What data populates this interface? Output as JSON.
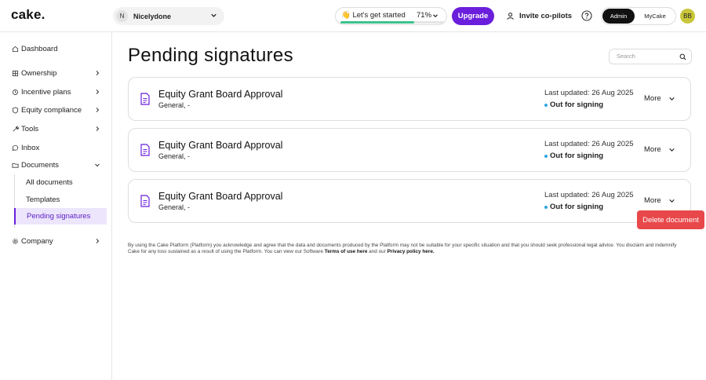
{
  "header": {
    "logo_text": "cake.",
    "company": {
      "initial": "N",
      "name": "Nicelydone"
    },
    "get_started": {
      "label": "👋 Let's get started",
      "percent_text": "71%",
      "progress_fraction": 0.71,
      "progress_color": "#3cc28c"
    },
    "upgrade_label": "Upgrade",
    "invite_label": "Invite co-pilots",
    "mode": {
      "admin_label": "Admin",
      "mycake_label": "MyCake",
      "selected": "Admin"
    },
    "user_initials": "BB",
    "accent_color": "#6b1fdc"
  },
  "sidebar": {
    "items": [
      {
        "label": "Dashboard",
        "icon": "home-icon",
        "has_chevron": false
      },
      {
        "label": "Ownership",
        "icon": "grid-icon",
        "has_chevron": true
      },
      {
        "label": "Incentive plans",
        "icon": "cycle-icon",
        "has_chevron": true
      },
      {
        "label": "Equity compliance",
        "icon": "shield-icon",
        "has_chevron": true
      },
      {
        "label": "Tools",
        "icon": "wrench-icon",
        "has_chevron": true
      },
      {
        "label": "Inbox",
        "icon": "chat-icon",
        "has_chevron": false
      },
      {
        "label": "Documents",
        "icon": "folder-icon",
        "has_chevron": true,
        "expanded": true
      },
      {
        "label": "Company",
        "icon": "gear-icon",
        "has_chevron": true
      }
    ],
    "documents_sub": [
      {
        "label": "All documents",
        "active": false
      },
      {
        "label": "Templates",
        "active": false
      },
      {
        "label": "Pending signatures",
        "active": true
      }
    ]
  },
  "main": {
    "title": "Pending signatures",
    "search_placeholder": "Search",
    "documents": [
      {
        "title": "Equity Grant Board Approval",
        "subtitle": "General, -",
        "updated": "Last updated: 26 Aug 2025",
        "status": "Out for signing",
        "more_label": "More"
      },
      {
        "title": "Equity Grant Board Approval",
        "subtitle": "General, -",
        "updated": "Last updated: 26 Aug 2025",
        "status": "Out for signing",
        "more_label": "More"
      },
      {
        "title": "Equity Grant Board Approval",
        "subtitle": "General, -",
        "updated": "Last updated: 26 Aug 2025",
        "status": "Out for signing",
        "more_label": "More"
      }
    ],
    "dropdown": {
      "delete_label": "Delete document",
      "color": "#e8484a"
    },
    "disclaimer": {
      "text": "By using the Cake Platform (Platform) you acknowledge and agree that the data and documents produced by the Platform may not be suitable for your specific situation and that you should seek professional legal advice. You disclaim and indemnify Cake for any loss sustained as a result of using the Platform. You can view our Software",
      "terms_link": "Terms of use here",
      "connector": "and our",
      "privacy_link": "Privacy policy here."
    }
  }
}
